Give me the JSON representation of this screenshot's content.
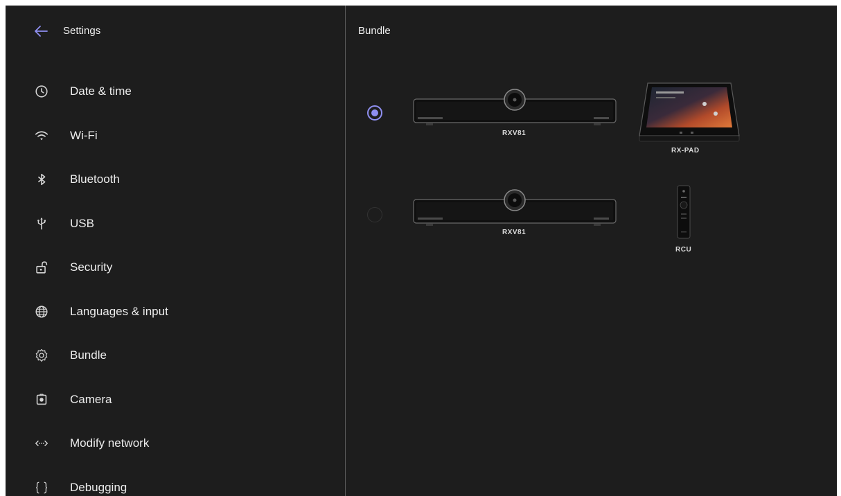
{
  "sidebar": {
    "title": "Settings",
    "back_icon": "arrow-left-icon",
    "items": [
      {
        "label": "Date & time",
        "icon": "clock-icon"
      },
      {
        "label": "Wi-Fi",
        "icon": "wifi-icon"
      },
      {
        "label": "Bluetooth",
        "icon": "bluetooth-icon"
      },
      {
        "label": "USB",
        "icon": "usb-icon"
      },
      {
        "label": "Security",
        "icon": "unlock-icon"
      },
      {
        "label": "Languages & input",
        "icon": "globe-icon"
      },
      {
        "label": "Bundle",
        "icon": "gear-icon"
      },
      {
        "label": "Camera",
        "icon": "camera-icon"
      },
      {
        "label": "Modify network",
        "icon": "network-arrows-icon"
      },
      {
        "label": "Debugging",
        "icon": "braces-icon"
      }
    ]
  },
  "main": {
    "title": "Bundle",
    "options": [
      {
        "selected": true,
        "device_a": "RXV81",
        "device_b": "RX-PAD"
      },
      {
        "selected": false,
        "device_a": "RXV81",
        "device_b": "RCU"
      }
    ]
  },
  "colors": {
    "background": "#1d1d1d",
    "accent": "#8f8ff0",
    "divider": "#5a5a5a",
    "text": "#ececec"
  }
}
